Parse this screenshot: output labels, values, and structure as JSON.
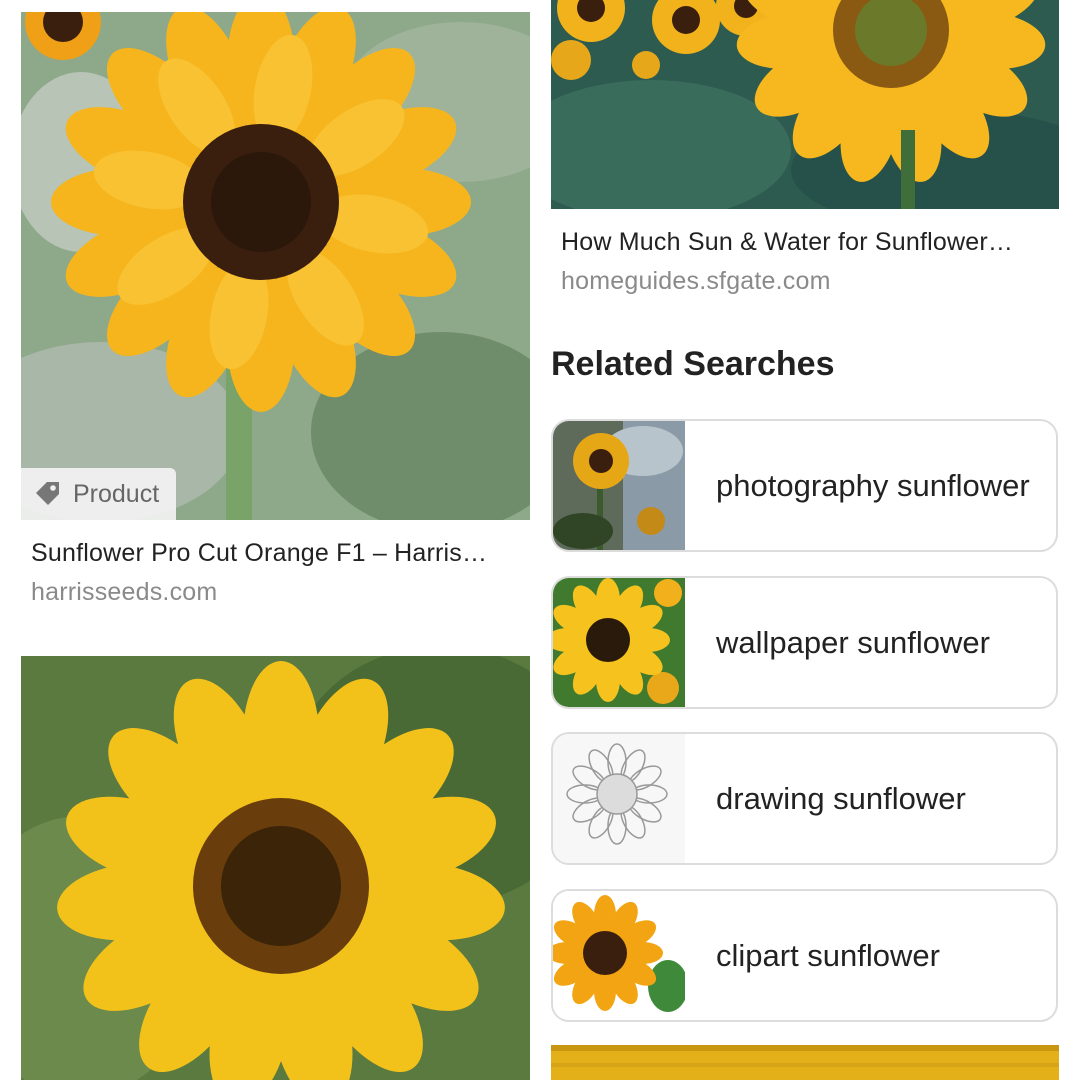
{
  "results": [
    {
      "badge": "Product",
      "title": "Sunflower Pro Cut Orange F1 – Harris…",
      "source": "harrisseeds.com"
    },
    {
      "title": "How Much Sun & Water for Sunflower…",
      "source": "homeguides.sfgate.com"
    }
  ],
  "related": {
    "heading": "Related Searches",
    "items": [
      {
        "label": "photography sunflower"
      },
      {
        "label": "wallpaper sunflower"
      },
      {
        "label": "drawing sunflower"
      },
      {
        "label": "clipart sunflower"
      }
    ]
  },
  "colors": {
    "petal": "#f6b51c",
    "center": "#3a1f0f",
    "leaf": "#5f8a55",
    "border": "#dcdcdc",
    "source_text": "#8a8a8a"
  }
}
